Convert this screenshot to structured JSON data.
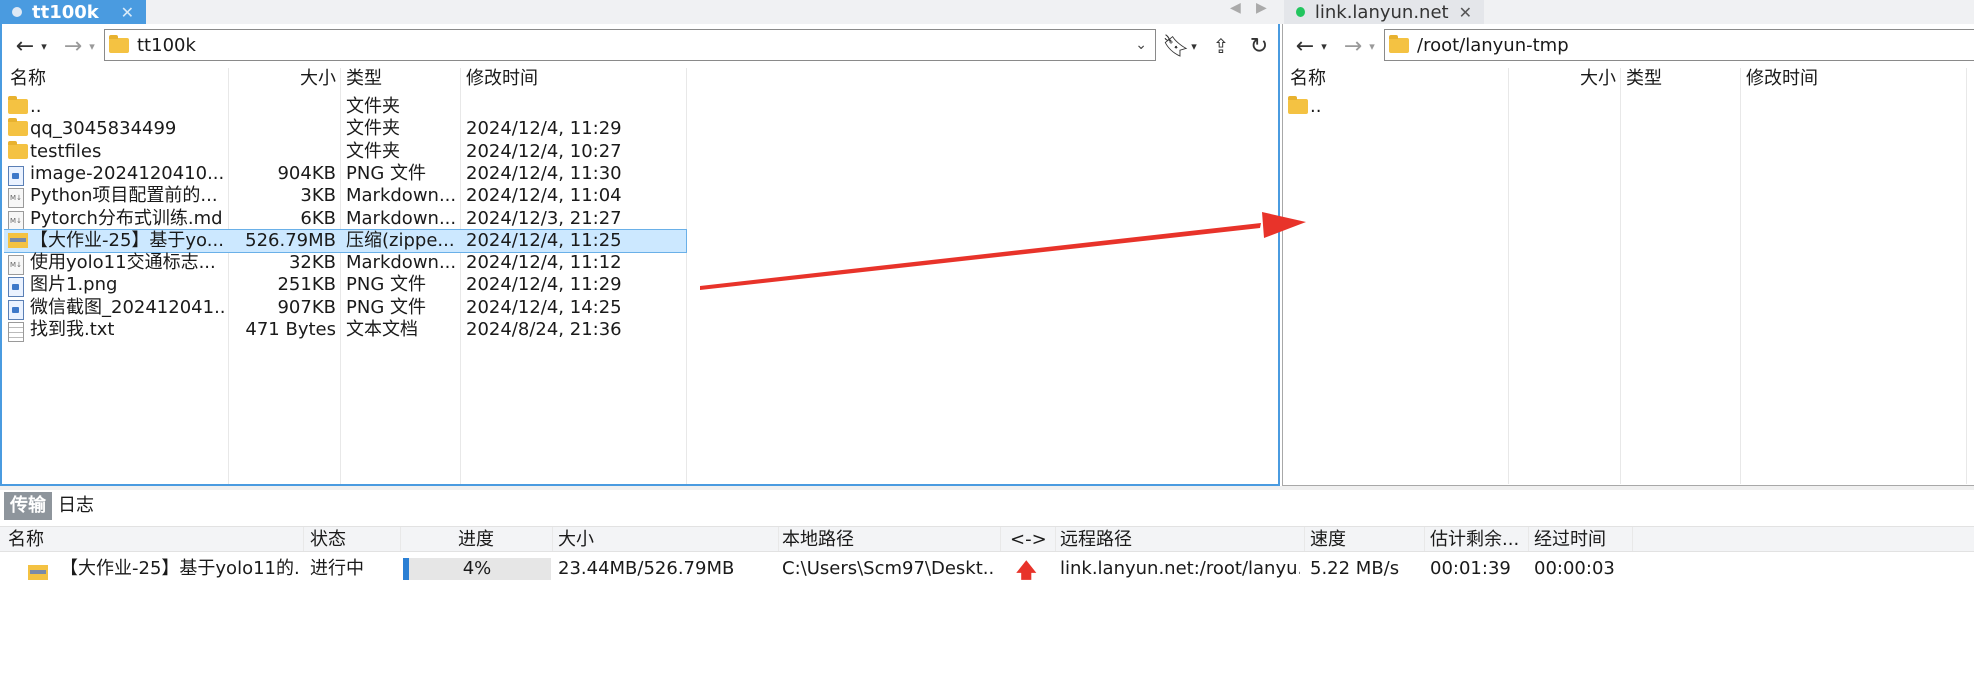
{
  "left_tab": {
    "label": "tt100k",
    "close": "✕"
  },
  "right_tab": {
    "label": "link.lanyun.net",
    "close": "✕"
  },
  "left_path": "tt100k",
  "right_path": "/root/lanyun-tmp",
  "file_columns": {
    "name": "名称",
    "size": "大小",
    "type": "类型",
    "modified": "修改时间"
  },
  "left_files": [
    {
      "icon": "folder-icon",
      "name": "..",
      "size": "",
      "type": "文件夹",
      "modified": ""
    },
    {
      "icon": "folder-icon",
      "name": "qq_3045834499",
      "size": "",
      "type": "文件夹",
      "modified": "2024/12/4, 11:29"
    },
    {
      "icon": "folder-icon",
      "name": "testfiles",
      "size": "",
      "type": "文件夹",
      "modified": "2024/12/4, 10:27"
    },
    {
      "icon": "png-file-icon",
      "name": "image-2024120410...",
      "size": "904KB",
      "type": "PNG 文件",
      "modified": "2024/12/4, 11:30"
    },
    {
      "icon": "markdown-file-icon",
      "name": "Python项目配置前的...",
      "size": "3KB",
      "type": "Markdown...",
      "modified": "2024/12/4, 11:04"
    },
    {
      "icon": "markdown-file-icon",
      "name": "Pytorch分布式训练.md",
      "size": "6KB",
      "type": "Markdown...",
      "modified": "2024/12/3, 21:27"
    },
    {
      "icon": "zip-file-icon",
      "name": "【大作业-25】基于yo...",
      "size": "526.79MB",
      "type": "压缩(zippe...",
      "modified": "2024/12/4, 11:25"
    },
    {
      "icon": "markdown-file-icon",
      "name": "使用yolo11交通标志...",
      "size": "32KB",
      "type": "Markdown...",
      "modified": "2024/12/4, 11:12"
    },
    {
      "icon": "png-file-icon",
      "name": "图片1.png",
      "size": "251KB",
      "type": "PNG 文件",
      "modified": "2024/12/4, 11:29"
    },
    {
      "icon": "png-file-icon",
      "name": "微信截图_202412041...",
      "size": "907KB",
      "type": "PNG 文件",
      "modified": "2024/12/4, 14:25"
    },
    {
      "icon": "txt-file-icon",
      "name": "找到我.txt",
      "size": "471 Bytes",
      "type": "文本文档",
      "modified": "2024/8/24, 21:36"
    }
  ],
  "right_files": [
    {
      "icon": "folder-icon",
      "name": ".."
    }
  ],
  "bottom_tabs": {
    "transfer": "传输",
    "log": "日志"
  },
  "transfer_columns": {
    "name": "名称",
    "status": "状态",
    "progress": "进度",
    "size": "大小",
    "local_path": "本地路径",
    "direction": "<->",
    "remote_path": "远程路径",
    "speed": "速度",
    "eta": "估计剩余...",
    "elapsed": "经过时间"
  },
  "transfer": {
    "name": "【大作业-25】基于yolo11的...",
    "status": "进行中",
    "progress_text": "4%",
    "progress_fraction": 0.04,
    "size": "23.44MB/526.79MB",
    "local_path": "C:\\Users\\Scm97\\Deskt...",
    "remote_path": "link.lanyun.net:/root/lanyu...",
    "speed": "5.22 MB/s",
    "eta": "00:01:39",
    "elapsed": "00:00:03"
  },
  "colors": {
    "accent": "#4a9be0",
    "selection": "#cce8ff",
    "arrow": "#e8332a",
    "online": "#22c55e"
  }
}
